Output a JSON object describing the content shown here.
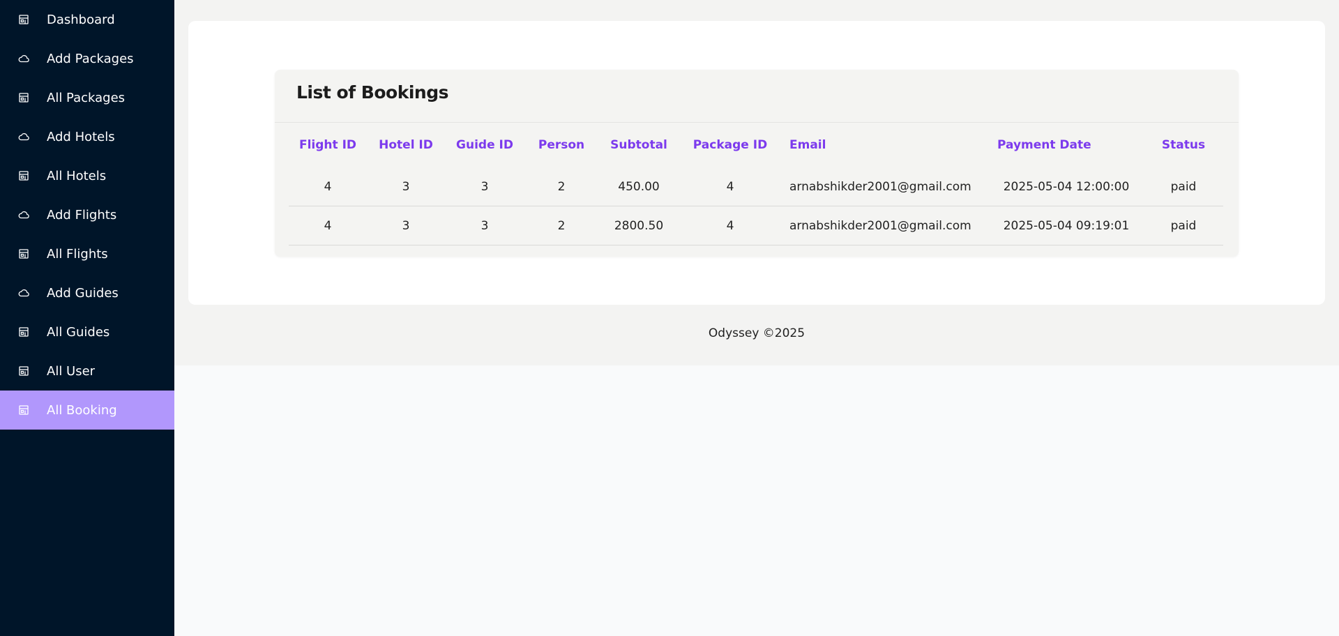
{
  "sidebar": {
    "items": [
      {
        "label": "Dashboard",
        "icon": "store-icon",
        "active": false
      },
      {
        "label": "Add Packages",
        "icon": "cloud-icon",
        "active": false
      },
      {
        "label": "All Packages",
        "icon": "store-icon",
        "active": false
      },
      {
        "label": "Add Hotels",
        "icon": "cloud-icon",
        "active": false
      },
      {
        "label": "All Hotels",
        "icon": "store-icon",
        "active": false
      },
      {
        "label": "Add Flights",
        "icon": "cloud-icon",
        "active": false
      },
      {
        "label": "All Flights",
        "icon": "store-icon",
        "active": false
      },
      {
        "label": "Add Guides",
        "icon": "cloud-icon",
        "active": false
      },
      {
        "label": "All Guides",
        "icon": "store-icon",
        "active": false
      },
      {
        "label": "All User",
        "icon": "store-icon",
        "active": false
      },
      {
        "label": "All Booking",
        "icon": "store-icon",
        "active": true
      }
    ],
    "background_color": "#001529",
    "active_color": "#b197fc"
  },
  "bookings": {
    "title": "List of Bookings",
    "columns": [
      "Flight ID",
      "Hotel ID",
      "Guide ID",
      "Person",
      "Subtotal",
      "Package ID",
      "Email",
      "Payment Date",
      "Status"
    ],
    "rows": [
      [
        "4",
        "3",
        "3",
        "2",
        "450.00",
        "4",
        "arnabshikder2001@gmail.com",
        "2025-05-04 12:00:00",
        "paid"
      ],
      [
        "4",
        "3",
        "3",
        "2",
        "2800.50",
        "4",
        "arnabshikder2001@gmail.com",
        "2025-05-04 09:19:01",
        "paid"
      ]
    ],
    "header_color": "#7c3aed"
  },
  "footer": {
    "text": "Odyssey ©2025"
  }
}
